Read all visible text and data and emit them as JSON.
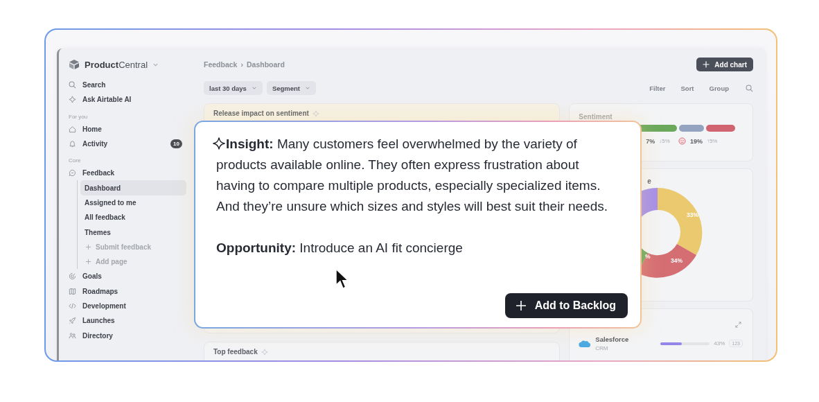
{
  "sidebar": {
    "workspace": "**Product**Central",
    "top_items": [
      {
        "label": "Search"
      },
      {
        "label": "Ask Airtable AI"
      }
    ],
    "sections": [
      {
        "heading": "For you",
        "items": [
          {
            "label": "Home"
          },
          {
            "label": "Activity",
            "badge": "10"
          }
        ]
      },
      {
        "heading": "Core",
        "items": [
          {
            "label": "Feedback",
            "children": [
              {
                "label": "Dashboard",
                "kind": "page",
                "selected": true
              },
              {
                "label": "Assigned to me",
                "kind": "page",
                "selected": false
              },
              {
                "label": "All feedback",
                "kind": "page",
                "selected": false
              },
              {
                "label": "Themes",
                "kind": "page",
                "selected": false
              },
              {
                "label": "Submit feedback",
                "kind": "action",
                "selected": false
              },
              {
                "label": "Add page",
                "kind": "action",
                "selected": false
              }
            ]
          },
          {
            "label": "Goals"
          },
          {
            "label": "Roadmaps"
          },
          {
            "label": "Development"
          },
          {
            "label": "Launches"
          },
          {
            "label": "Directory"
          }
        ]
      }
    ]
  },
  "breadcrumb": [
    "Feedback",
    "Dashboard"
  ],
  "breadcrumb_separator": "›",
  "add_chart_button": "Add chart",
  "filters": [
    "last 30 days",
    "Segment"
  ],
  "toolbar": [
    "Filter",
    "Sort",
    "Group"
  ],
  "cards": {
    "release": {
      "title": "Release impact on sentiment"
    },
    "top_feedback": {
      "title": "Top feedback"
    }
  },
  "sentiment": {
    "title": "Sentiment",
    "stats": [
      {
        "value": "7%",
        "change": "↓5%",
        "kind": "plain"
      },
      {
        "value": "19%",
        "change": "↑5%",
        "kind": "negative"
      }
    ]
  },
  "breakdown": {
    "title": "e",
    "slice_labels": [
      "33%",
      "34%",
      "%"
    ]
  },
  "sources": [
    {
      "name": "Salesforce",
      "type": "CRM",
      "level": 0.43,
      "percent": "43%",
      "count": "123"
    }
  ],
  "insight": {
    "text": "**Insight:** Many customers feel overwhelmed by the variety of products available online. They often express frustration about having to compare multiple products, especially specialized items. And they’re unsure which sizes and styles will best suit their needs.",
    "opportunity": "**Opportunity:** Introduce an AI fit concierge",
    "button": "Add to Backlog"
  }
}
